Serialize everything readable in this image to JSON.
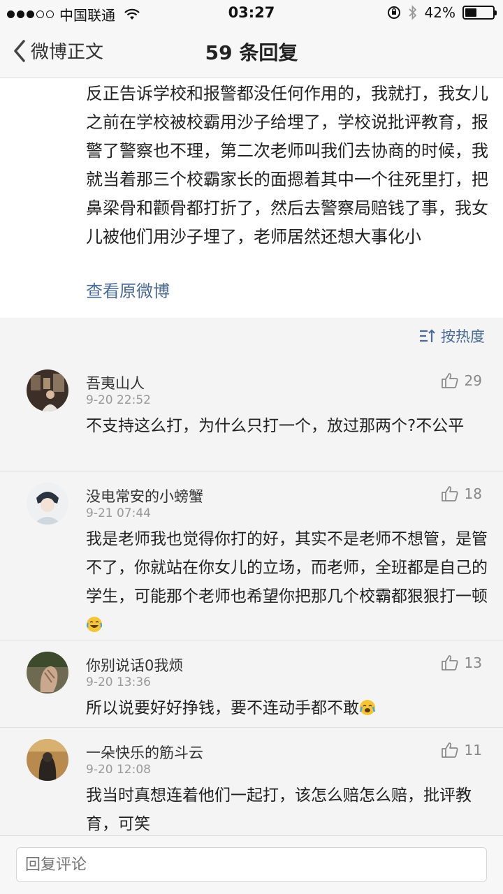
{
  "status_bar": {
    "carrier": "中国联通",
    "time": "03:27",
    "battery": "42%",
    "battery_level": 0.42
  },
  "nav": {
    "back_label": "微博正文",
    "title": "59 条回复"
  },
  "post": {
    "text": "反正告诉学校和报警都没任何作用的，我就打，我女儿之前在学校被校霸用沙子给埋了，学校说批评教育，报警了警察也不理，第二次老师叫我们去协商的时候，我就当着那三个校霸家长的面摁着其中一个往死里打，把鼻梁骨和颧骨都打折了，然后去警察局赔钱了事，我女儿被他们用沙子埋了，老师居然还想大事化小",
    "view_original": "查看原微博"
  },
  "sort": {
    "label": "按热度"
  },
  "comments": [
    {
      "name": "吾夷山人",
      "time": "9-20 22:52",
      "likes": "29",
      "text": "不支持这么打，为什么只打一个，放过那两个?不公平"
    },
    {
      "name": "没电常安的小螃蟹",
      "time": "9-21 07:44",
      "likes": "18",
      "text": "我是老师我也觉得你打的好，其实不是老师不想管，是管不了，你就站在你女儿的立场，而老师，全班都是自己的学生，可能那个老师也希望你把那几个校霸都狠狠打一顿"
    },
    {
      "name": "你别说话0我烦",
      "time": "9-20 13:36",
      "likes": "13",
      "text": "所以说要好好挣钱，要不连动手都不敢"
    },
    {
      "name": "一朵快乐的筋斗云",
      "time": "9-20 12:08",
      "likes": "11",
      "text": "我当时真想连着他们一起打，该怎么赔怎么赔，批评教育，可笑"
    }
  ],
  "reply": {
    "placeholder": "回复评论"
  }
}
